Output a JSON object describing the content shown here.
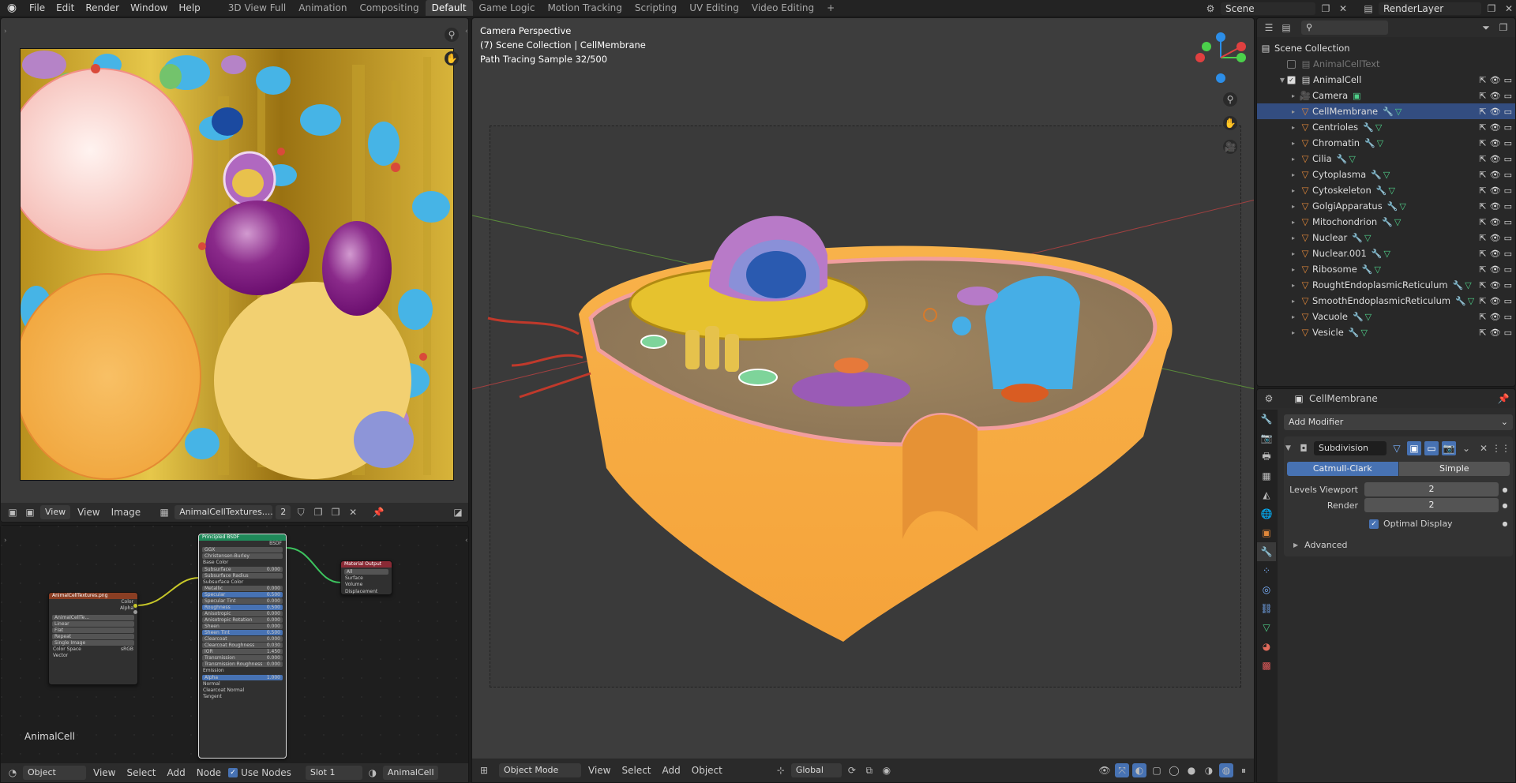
{
  "topbar": {
    "menus": [
      "File",
      "Edit",
      "Render",
      "Window",
      "Help"
    ],
    "workspaces": [
      "3D View Full",
      "Animation",
      "Compositing",
      "Default",
      "Game Logic",
      "Motion Tracking",
      "Scripting",
      "UV Editing",
      "Video Editing"
    ],
    "active_workspace": "Default",
    "add_tab": "+",
    "scene": "Scene",
    "view_layer": "RenderLayer"
  },
  "image_editor": {
    "view_menu": "View",
    "menus": [
      "View",
      "Image"
    ],
    "image_name": "AnimalCellTextures....",
    "users": "2"
  },
  "node_editor": {
    "label": "AnimalCell",
    "type": "Object",
    "menus": [
      "View",
      "Select",
      "Add",
      "Node"
    ],
    "use_nodes_label": "Use Nodes",
    "slot": "Slot 1",
    "material": "AnimalCell",
    "nodes": {
      "tex": {
        "title": "AnimalCellTextures.png",
        "out1": "Color",
        "out2": "Alpha",
        "img": "AnimalCellTe...",
        "rows": [
          "Linear",
          "Flat",
          "Repeat",
          "Single Image"
        ],
        "colorspace_label": "Color Space",
        "colorspace": "sRGB",
        "vector": "Vector"
      },
      "bsdf": {
        "title": "Principled BSDF",
        "out": "BSDF",
        "dist": "GGX",
        "ss": "Christensen-Burley",
        "rows": [
          {
            "l": "Base Color",
            "v": "",
            "t": "sock"
          },
          {
            "l": "Subsurface",
            "v": "0.000",
            "t": "bar"
          },
          {
            "l": "Subsurface Radius",
            "v": "",
            "t": "bar"
          },
          {
            "l": "Subsurface Color",
            "v": "",
            "t": "sock"
          },
          {
            "l": "Metallic",
            "v": "0.000",
            "t": "bar"
          },
          {
            "l": "Specular",
            "v": "0.500",
            "t": "blue"
          },
          {
            "l": "Specular Tint",
            "v": "0.000",
            "t": "bar"
          },
          {
            "l": "Roughness",
            "v": "0.500",
            "t": "blue"
          },
          {
            "l": "Anisotropic",
            "v": "0.000",
            "t": "bar"
          },
          {
            "l": "Anisotropic Rotation",
            "v": "0.000",
            "t": "bar"
          },
          {
            "l": "Sheen",
            "v": "0.000",
            "t": "bar"
          },
          {
            "l": "Sheen Tint",
            "v": "0.500",
            "t": "blue"
          },
          {
            "l": "Clearcoat",
            "v": "0.000",
            "t": "bar"
          },
          {
            "l": "Clearcoat Roughness",
            "v": "0.030",
            "t": "bar"
          },
          {
            "l": "IOR",
            "v": "1.450",
            "t": "bar"
          },
          {
            "l": "Transmission",
            "v": "0.000",
            "t": "bar"
          },
          {
            "l": "Transmission Roughness",
            "v": "0.000",
            "t": "bar"
          },
          {
            "l": "Emission",
            "v": "",
            "t": "sock"
          },
          {
            "l": "Alpha",
            "v": "1.000",
            "t": "blue"
          },
          {
            "l": "Normal",
            "v": "",
            "t": "sock"
          },
          {
            "l": "Clearcoat Normal",
            "v": "",
            "t": "sock"
          },
          {
            "l": "Tangent",
            "v": "",
            "t": "sock"
          }
        ]
      },
      "out": {
        "title": "Material Output",
        "target": "All",
        "rows": [
          "Surface",
          "Volume",
          "Displacement"
        ]
      }
    }
  },
  "viewport": {
    "overlay_line1": "Camera Perspective",
    "overlay_line2": "(7) Scene Collection | CellMembrane",
    "overlay_line3": "Path Tracing Sample 32/500",
    "mode": "Object Mode",
    "menus": [
      "View",
      "Select",
      "Add",
      "Object"
    ],
    "transform": "Global"
  },
  "outliner": {
    "root": "Scene Collection",
    "items": [
      {
        "name": "AnimalCellText",
        "depth": 1,
        "kind": "collection",
        "disabled": true
      },
      {
        "name": "AnimalCell",
        "depth": 1,
        "kind": "collection"
      },
      {
        "name": "Camera",
        "depth": 2,
        "kind": "camera"
      },
      {
        "name": "CellMembrane",
        "depth": 2,
        "kind": "mesh",
        "selected": true
      },
      {
        "name": "Centrioles",
        "depth": 2,
        "kind": "mesh"
      },
      {
        "name": "Chromatin",
        "depth": 2,
        "kind": "mesh"
      },
      {
        "name": "Cilia",
        "depth": 2,
        "kind": "mesh"
      },
      {
        "name": "Cytoplasma",
        "depth": 2,
        "kind": "mesh"
      },
      {
        "name": "Cytoskeleton",
        "depth": 2,
        "kind": "mesh"
      },
      {
        "name": "GolgiApparatus",
        "depth": 2,
        "kind": "mesh"
      },
      {
        "name": "Mitochondrion",
        "depth": 2,
        "kind": "mesh"
      },
      {
        "name": "Nuclear",
        "depth": 2,
        "kind": "mesh"
      },
      {
        "name": "Nuclear.001",
        "depth": 2,
        "kind": "mesh"
      },
      {
        "name": "Ribosome",
        "depth": 2,
        "kind": "mesh"
      },
      {
        "name": "RoughtEndoplasmicReticulum",
        "depth": 2,
        "kind": "mesh"
      },
      {
        "name": "SmoothEndoplasmicReticulum",
        "depth": 2,
        "kind": "mesh"
      },
      {
        "name": "Vacuole",
        "depth": 2,
        "kind": "mesh"
      },
      {
        "name": "Vesicle",
        "depth": 2,
        "kind": "mesh"
      }
    ]
  },
  "properties": {
    "object": "CellMembrane",
    "add_modifier": "Add Modifier",
    "modifier_name": "Subdivision",
    "algo_a": "Catmull-Clark",
    "algo_b": "Simple",
    "levels_label": "Levels Viewport",
    "levels_value": "2",
    "render_label": "Render",
    "render_value": "2",
    "optimal_label": "Optimal Display",
    "advanced_label": "Advanced"
  }
}
